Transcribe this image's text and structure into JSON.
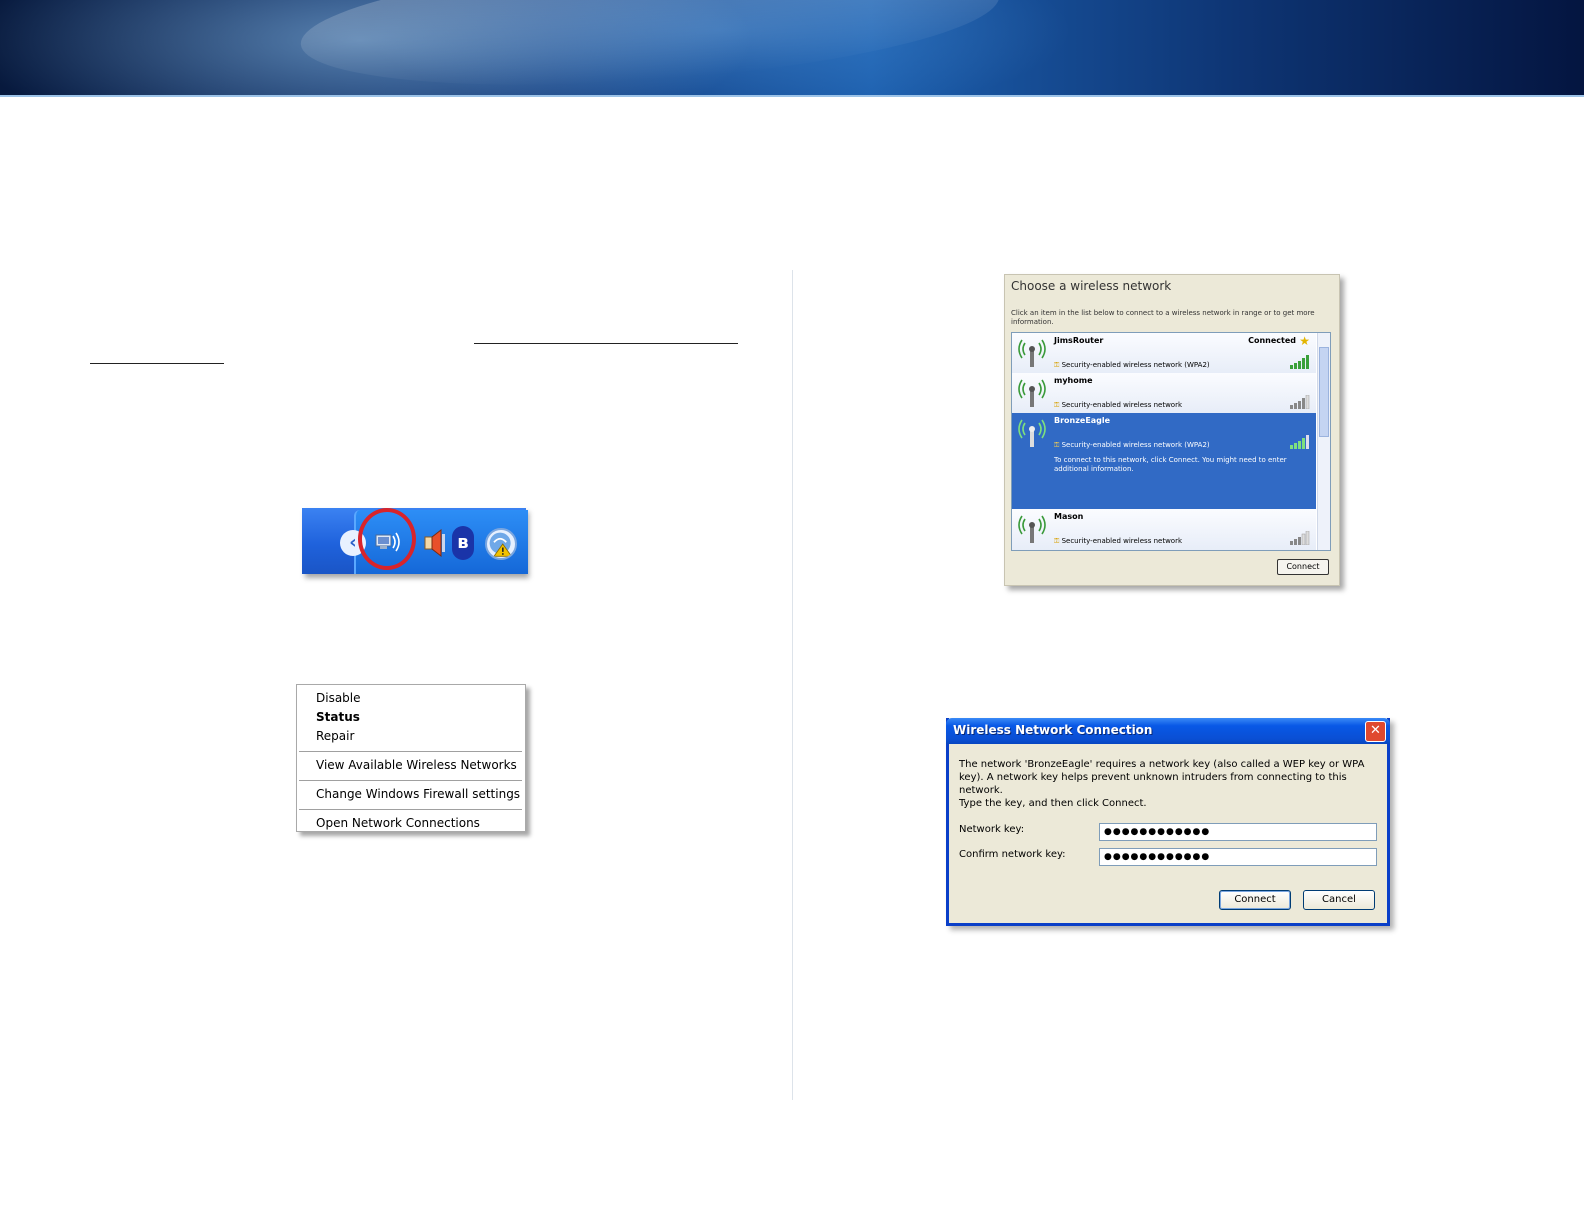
{
  "tray": {
    "icons": [
      "chevron-left-icon",
      "wireless-network-icon",
      "speaker-icon",
      "bluetooth-icon",
      "security-warning-icon"
    ],
    "chevron_glyph": "‹",
    "bluetooth_glyph": "ʙ"
  },
  "context_menu": {
    "items": [
      {
        "label": "Disable"
      },
      {
        "label": "Status"
      },
      {
        "label": "Repair"
      },
      {
        "label": "View Available Wireless Networks"
      },
      {
        "label": "Change Windows Firewall settings"
      },
      {
        "label": "Open Network Connections"
      }
    ]
  },
  "choose_network": {
    "title": "Choose a wireless network",
    "description": "Click an item in the list below to connect to a wireless network in range or to get more information.",
    "networks": [
      {
        "name": "JimsRouter",
        "security": "Security-enabled wireless network (WPA2)",
        "status": "Connected",
        "signal_bars": 5
      },
      {
        "name": "myhome",
        "security": "Security-enabled wireless network",
        "status": "",
        "signal_bars": 4
      },
      {
        "name": "BronzeEagle",
        "security": "Security-enabled wireless network (WPA2)",
        "status": "",
        "signal_bars": 4,
        "hint": "To connect to this network, click Connect. You might need to enter additional information."
      },
      {
        "name": "Mason",
        "security": "Security-enabled wireless network",
        "status": "",
        "signal_bars": 3
      }
    ],
    "connect_label": "Connect"
  },
  "wnc_dialog": {
    "title": "Wireless Network Connection",
    "close_glyph": "✕",
    "message": "The network 'BronzeEagle' requires a network key (also called a WEP key or WPA key). A network key helps prevent unknown intruders from connecting to this network.",
    "instruction": "Type the key, and then click Connect.",
    "network_key_label": "Network key:",
    "network_key_value": "●●●●●●●●●●●●",
    "confirm_key_label": "Confirm network key:",
    "confirm_key_value": "●●●●●●●●●●●●",
    "connect_label": "Connect",
    "cancel_label": "Cancel"
  },
  "colors": {
    "tray_blue": "#2f6fe0",
    "highlight_circle": "#d8242a",
    "selection_blue": "#316ac5",
    "dialog_titlebar": "#0858e6",
    "dialog_face": "#ece9d8"
  }
}
